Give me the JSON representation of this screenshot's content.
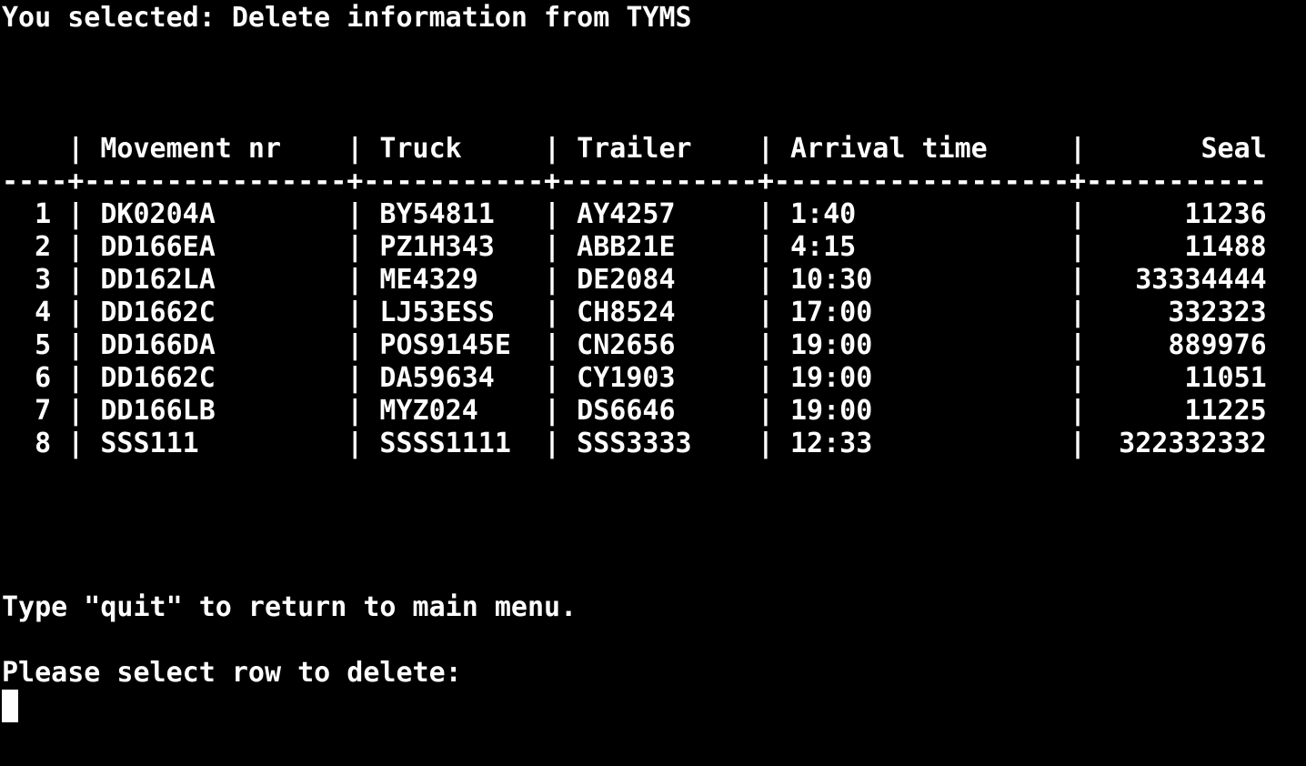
{
  "terminal": {
    "selected_line": "You selected: Delete information from TYMS",
    "table": {
      "header_line": "    | Movement nr    | Truck     | Trailer    | Arrival time     |       Seal",
      "separator_line": "----+----------------+-----------+------------+------------------+-----------",
      "rows": [
        "  1 | DK0204A        | BY54811   | AY4257     | 1:40             |      11236",
        "  2 | DD166EA        | PZ1H343   | ABB21E     | 4:15             |      11488",
        "  3 | DD162LA        | ME4329    | DE2084     | 10:30            |   33334444",
        "  4 | DD1662C        | LJ53ESS   | CH8524     | 17:00            |     332323",
        "  5 | DD166DA        | POS9145E  | CN2656     | 19:00            |     889976",
        "  6 | DD1662C        | DA59634   | CY1903     | 19:00            |      11051",
        "  7 | DD166LB        | MYZ024    | DS6646     | 19:00            |      11225",
        "  8 | SSS111         | SSSS1111  | SSS3333    | 12:33            |  322332332"
      ]
    },
    "quit_hint": "Type \"quit\" to return to main menu.",
    "prompt": "Please select row to delete:"
  }
}
